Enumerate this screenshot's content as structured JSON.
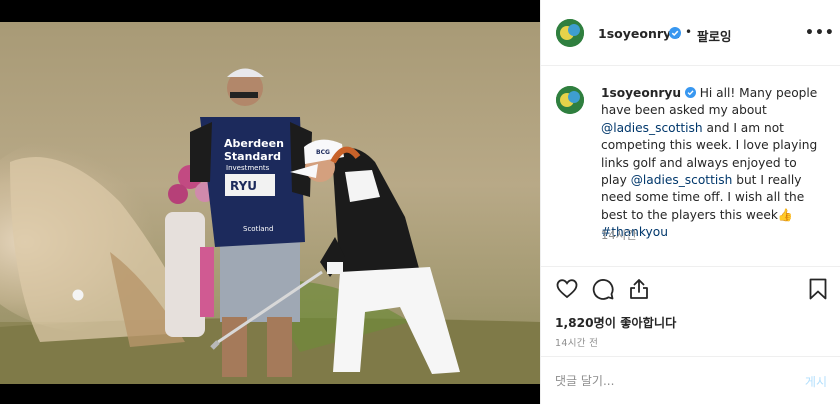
{
  "post": {
    "username": "1soyeonryu",
    "follow_label": "팔로잉",
    "separator": "•",
    "more_label": "•••",
    "caption_parts": {
      "p1": "Hi all! Many people have been asked my about ",
      "mention1": "@ladies_scottish",
      "p2": " and I am not competing this week. I love playing links golf and always enjoyed to play ",
      "mention2": "@ladies_scottish",
      "p3": " but I really need some time off. I wish all the best to the players this week",
      "emoji": "👍",
      "hashtag": "#thankyou"
    },
    "caption_time": "14시간",
    "likes": "1,820명이 좋아합니다",
    "post_time": "14시간 전",
    "comment_placeholder": "댓글 달기...",
    "post_button": "게시"
  },
  "photo": {
    "bib_line1": "Aberdeen",
    "bib_line2": "Standard",
    "bib_line3": "Investments",
    "bib_name": "RYU",
    "bib_footer": "Scotland",
    "visor_text": "BCG"
  },
  "colors": {
    "link": "#00376b",
    "verified": "#3897f0",
    "bib_navy": "#1c2a5c"
  },
  "icons": [
    "heart-icon",
    "comment-icon",
    "share-icon",
    "bookmark-icon",
    "verified-icon"
  ]
}
